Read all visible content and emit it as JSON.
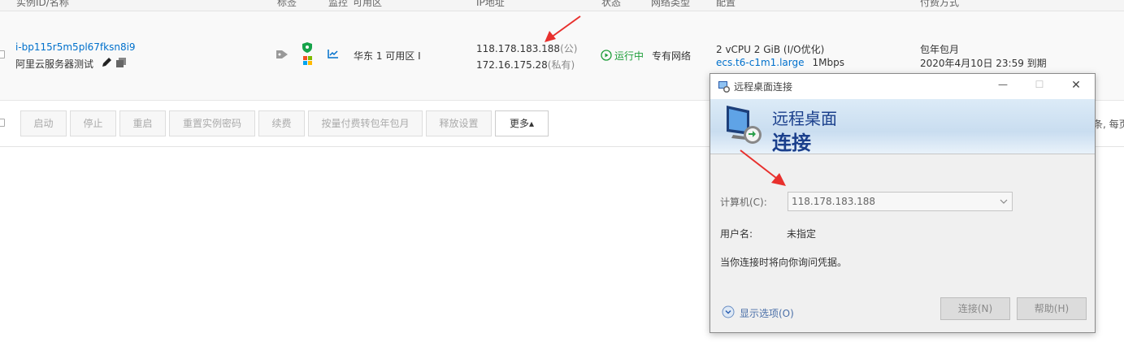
{
  "header": {
    "instance_col": "实例ID/名称",
    "tag_col": "标签",
    "monitor_col": "监控",
    "zone_col": "可用区",
    "ip_col": "IP地址",
    "status_col": "状态",
    "network_col": "网络类型",
    "config_col": "配置",
    "billing_col": "付费方式"
  },
  "instance": {
    "id": "i-bp115r5m5pl67fksn8i9",
    "name": "阿里云服务器测试",
    "zone": "华东 1 可用区 I",
    "public_ip": "118.178.183.188",
    "public_tag": "(公)",
    "private_ip": "172.16.175.28",
    "private_tag": "(私有)",
    "status": "运行中",
    "network": "专有网络",
    "config_line1": "2 vCPU 2 GiB (I/O优化)",
    "config_type": "ecs.t6-c1m1.large",
    "bandwidth": "1Mbps",
    "billing": "包年包月",
    "expire": "2020年4月10日 23:59 到期"
  },
  "toolbar": {
    "start": "启动",
    "stop": "停止",
    "restart": "重启",
    "reset_password": "重置实例密码",
    "renew": "续费",
    "convert": "按量付费转包年包月",
    "release": "释放设置",
    "more": "更多▴",
    "paging_fragment": "条, 每页"
  },
  "rdp": {
    "window_title": "远程桌面连接",
    "banner_line1": "远程桌面",
    "banner_line2": "连接",
    "computer_label": "计算机(C):",
    "computer_value": "118.178.183.188",
    "user_label": "用户名:",
    "user_value": "未指定",
    "prompt_text": "当你连接时将向你询问凭据。",
    "options_label": "显示选项(O)",
    "connect_button": "连接(N)",
    "help_button": "帮助(H)",
    "minimize": "—",
    "maximize": "☐",
    "close": "✕"
  },
  "colors": {
    "link": "#0070cc",
    "running": "#1e9e3a",
    "arrow": "#e8302d",
    "banner_text": "#1a3f8c"
  }
}
